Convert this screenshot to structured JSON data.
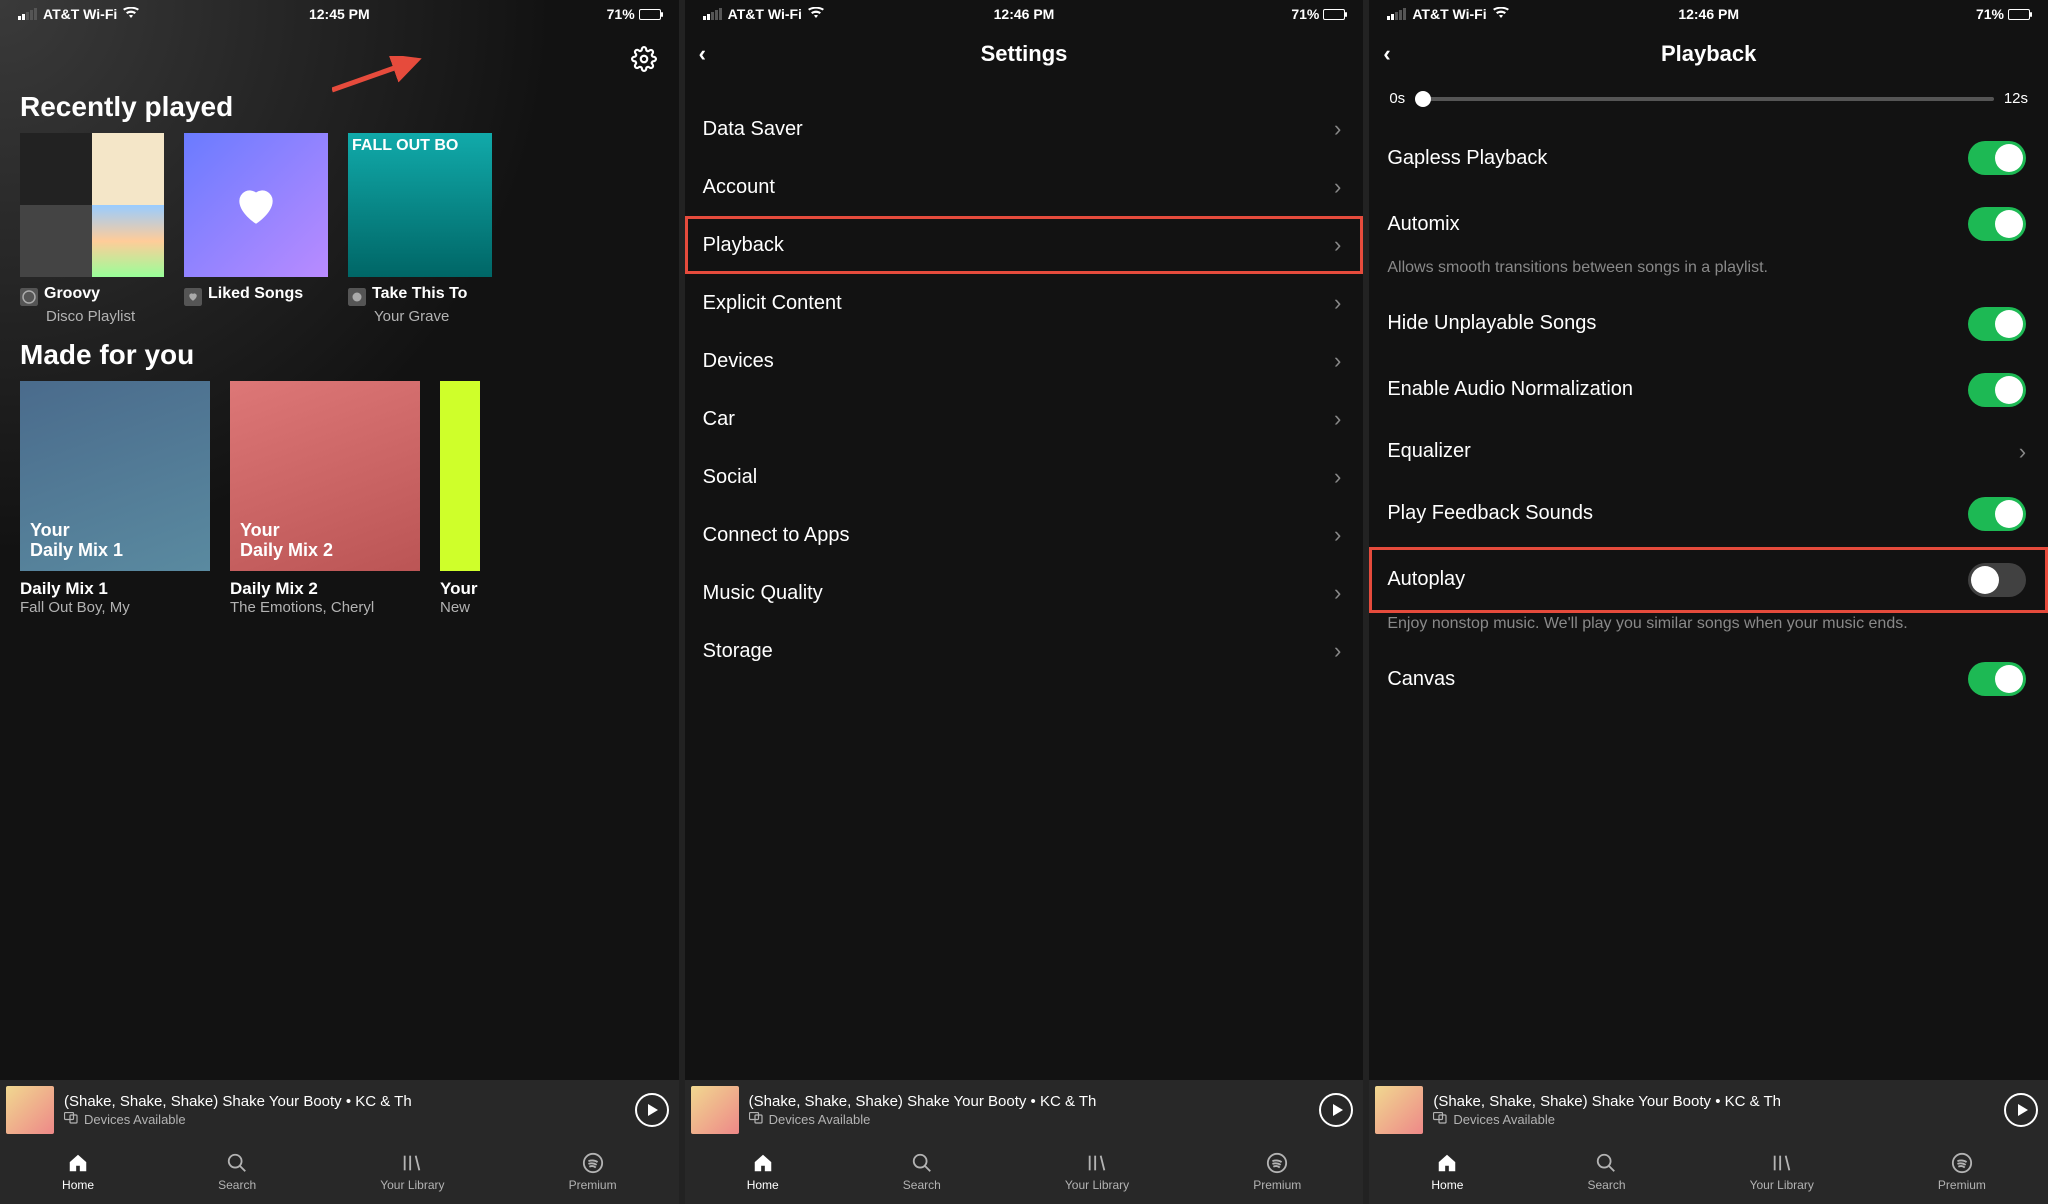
{
  "status": {
    "carrier": "AT&T Wi-Fi",
    "battery_pct": "71%"
  },
  "times": {
    "s1": "12:45 PM",
    "s2": "12:46 PM",
    "s3": "12:46 PM"
  },
  "home": {
    "recently_played_title": "Recently played",
    "made_for_you_title": "Made for you",
    "tiles": [
      {
        "title": "Groovy",
        "sub": "Disco Playlist"
      },
      {
        "title": "Liked Songs",
        "sub": ""
      },
      {
        "title": "Take This To",
        "sub": "Your Grave"
      }
    ],
    "made_tiles": [
      {
        "art_label": "Your\nDaily Mix 1",
        "title": "Daily Mix 1",
        "sub": "Fall Out Boy, My"
      },
      {
        "art_label": "Your\nDaily Mix 2",
        "title": "Daily Mix 2",
        "sub": "The Emotions, Cheryl"
      },
      {
        "art_label": "",
        "title": "Your",
        "sub": "New"
      }
    ]
  },
  "settings": {
    "header": "Settings",
    "items": [
      {
        "label": "Data Saver"
      },
      {
        "label": "Account"
      },
      {
        "label": "Playback"
      },
      {
        "label": "Explicit Content"
      },
      {
        "label": "Devices"
      },
      {
        "label": "Car"
      },
      {
        "label": "Social"
      },
      {
        "label": "Connect to Apps"
      },
      {
        "label": "Music Quality"
      },
      {
        "label": "Storage"
      }
    ]
  },
  "playback": {
    "header": "Playback",
    "slider_min": "0s",
    "slider_max": "12s",
    "items": {
      "gapless": "Gapless Playback",
      "automix": "Automix",
      "automix_desc": "Allows smooth transitions between songs in a playlist.",
      "hide": "Hide Unplayable Songs",
      "normalize": "Enable Audio Normalization",
      "equalizer": "Equalizer",
      "feedback": "Play Feedback Sounds",
      "autoplay": "Autoplay",
      "autoplay_desc": "Enjoy nonstop music. We'll play you similar songs when your music ends.",
      "canvas": "Canvas"
    }
  },
  "now_playing": {
    "title": "(Shake, Shake, Shake) Shake Your Booty • KC & Th",
    "devices": "Devices Available"
  },
  "nav": {
    "home": "Home",
    "search": "Search",
    "library": "Your Library",
    "premium": "Premium"
  }
}
